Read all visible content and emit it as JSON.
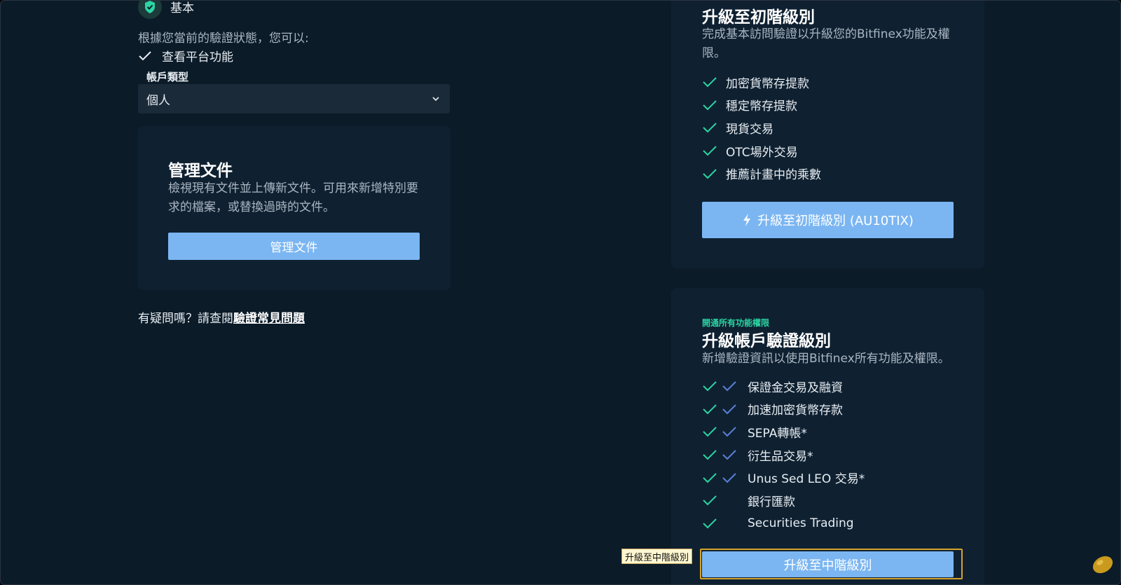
{
  "verification": {
    "level": "基本",
    "status_intro": "根據您當前的驗證狀態，您可以:",
    "current_feature": "查看平台功能"
  },
  "account": {
    "label": "帳戶類型",
    "value": "個人"
  },
  "documents": {
    "title": "管理文件",
    "description": "檢視現有文件並上傳新文件。可用來新增特別要求的檔案，或替換過時的文件。",
    "button": "管理文件"
  },
  "faq": {
    "prefix": "有疑問嗎？請查閱",
    "link": "驗證常見問題"
  },
  "starter": {
    "title": "升級至初階級別",
    "description": "完成基本訪問驗證以升級您的Bitfinex功能及權限。",
    "features": [
      "加密貨幣存提款",
      "穩定幣存提款",
      "現貨交易",
      "OTC場外交易",
      "推薦計畫中的乘數"
    ],
    "button": "升級至初階級別 (AU10TIX)"
  },
  "intermediate": {
    "eyebrow": "開通所有功能權限",
    "title": "升級帳戶驗證級別",
    "description": "新增驗證資訊以使用Bitfinex所有功能及權限。",
    "features": [
      {
        "label": "保證金交易及融資",
        "double": true
      },
      {
        "label": "加速加密貨幣存款",
        "double": true
      },
      {
        "label": "SEPA轉帳*",
        "double": true
      },
      {
        "label": "衍生品交易*",
        "double": true
      },
      {
        "label": "Unus Sed LEO 交易*",
        "double": true
      },
      {
        "label": "銀行匯款",
        "double": false
      },
      {
        "label": "Securities Trading",
        "double": false
      }
    ],
    "button": "升級至中階級別"
  },
  "tooltip": "升級至中階級別",
  "colors": {
    "background": "#0b1b28",
    "card": "#0f2131",
    "accent_blue": "#7bb6f2",
    "accent_green": "#2bd5a3",
    "secondary_check": "#5b7fd6",
    "highlight": "#d6a22b"
  }
}
